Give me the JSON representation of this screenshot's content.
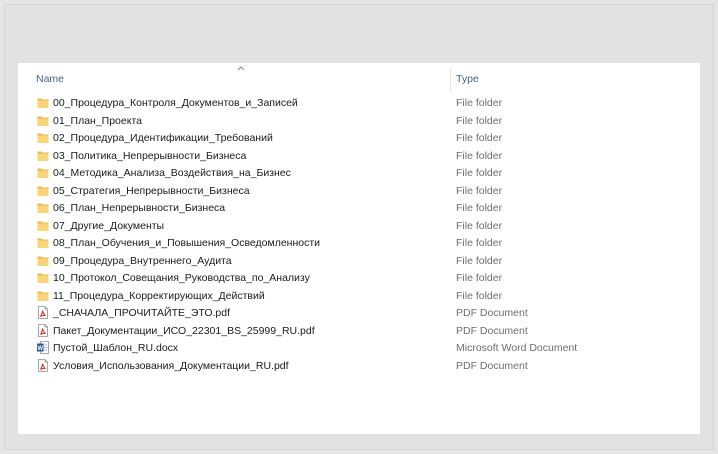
{
  "columns": {
    "name": "Name",
    "type": "Type"
  },
  "files": [
    {
      "name": "00_Процедура_Контроля_Документов_и_Записей",
      "type": "File folder",
      "icon": "folder-icon"
    },
    {
      "name": "01_План_Проекта",
      "type": "File folder",
      "icon": "folder-icon"
    },
    {
      "name": "02_Процедура_Идентификации_Требований",
      "type": "File folder",
      "icon": "folder-icon"
    },
    {
      "name": "03_Политика_Непрерывности_Бизнеса",
      "type": "File folder",
      "icon": "folder-icon"
    },
    {
      "name": "04_Методика_Анализа_Воздействия_на_Бизнес",
      "type": "File folder",
      "icon": "folder-icon"
    },
    {
      "name": "05_Стратегия_Непрерывности_Бизнеса",
      "type": "File folder",
      "icon": "folder-icon"
    },
    {
      "name": "06_План_Непрерывности_Бизнеса",
      "type": "File folder",
      "icon": "folder-icon"
    },
    {
      "name": "07_Другие_Документы",
      "type": "File folder",
      "icon": "folder-icon"
    },
    {
      "name": "08_План_Обучения_и_Повышения_Осведомленности",
      "type": "File folder",
      "icon": "folder-icon"
    },
    {
      "name": "09_Процедура_Внутреннего_Аудита",
      "type": "File folder",
      "icon": "folder-icon"
    },
    {
      "name": "10_Протокол_Совещания_Руководства_по_Анализу",
      "type": "File folder",
      "icon": "folder-icon"
    },
    {
      "name": "11_Процедура_Корректирующих_Действий",
      "type": "File folder",
      "icon": "folder-icon"
    },
    {
      "name": "_СНАЧАЛА_ПРОЧИТАЙТЕ_ЭТО.pdf",
      "type": "PDF Document",
      "icon": "pdf-icon"
    },
    {
      "name": "Пакет_Документации_ИСО_22301_BS_25999_RU.pdf",
      "type": "PDF Document",
      "icon": "pdf-icon"
    },
    {
      "name": "Пустой_Шаблон_RU.docx",
      "type": "Microsoft Word Document",
      "icon": "word-icon"
    },
    {
      "name": "Условия_Использования_Документации_RU.pdf",
      "type": "PDF Document",
      "icon": "pdf-icon"
    }
  ]
}
